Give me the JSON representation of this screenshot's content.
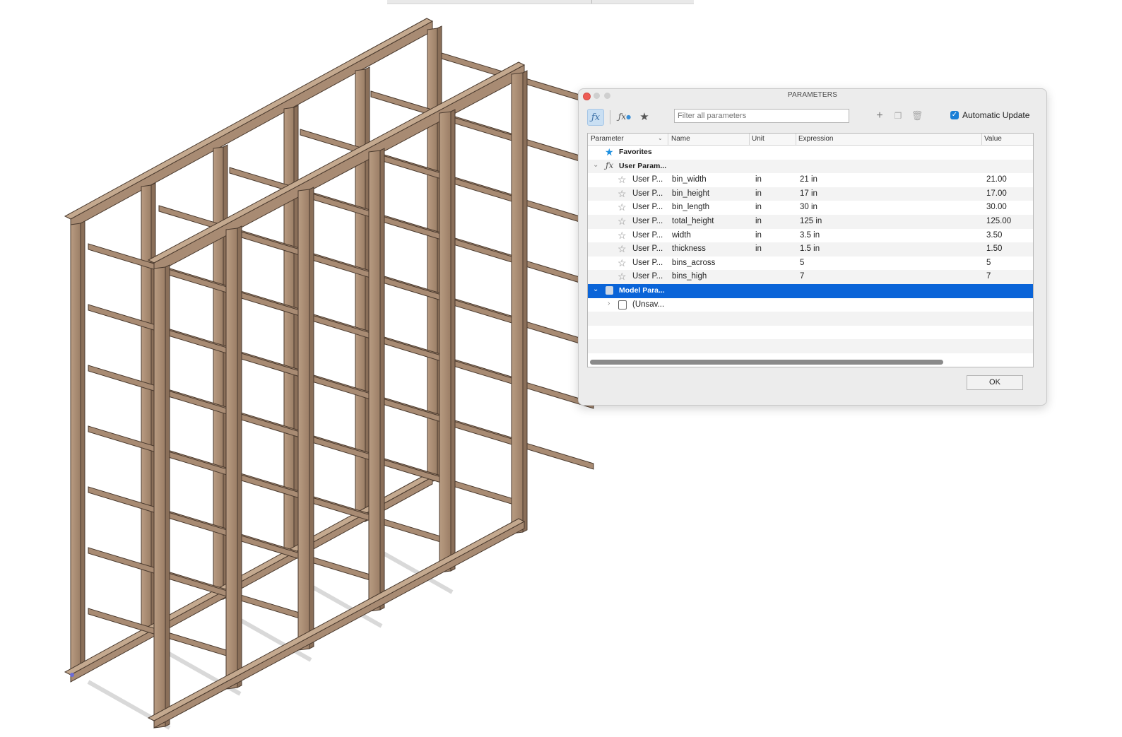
{
  "dialog": {
    "title": "PARAMETERS",
    "filter_placeholder": "Filter all parameters",
    "auto_update_label": "Automatic Update",
    "auto_update_checked": true,
    "ok_label": "OK",
    "toolbar_icons": [
      "fx-icon",
      "fx-user-icon",
      "star-icon",
      "plus-icon",
      "copy-icon",
      "trash-icon"
    ]
  },
  "table": {
    "columns": [
      "Parameter",
      "Name",
      "Unit",
      "Expression",
      "Value"
    ],
    "favorites_label": "Favorites",
    "user_group_label": "User Param...",
    "user_params": [
      {
        "param": "User P...",
        "name": "bin_width",
        "unit": "in",
        "expression": "21 in",
        "value": "21.00"
      },
      {
        "param": "User P...",
        "name": "bin_height",
        "unit": "in",
        "expression": "17 in",
        "value": "17.00"
      },
      {
        "param": "User P...",
        "name": "bin_length",
        "unit": "in",
        "expression": "30 in",
        "value": "30.00"
      },
      {
        "param": "User P...",
        "name": "total_height",
        "unit": "in",
        "expression": "125 in",
        "value": "125.00"
      },
      {
        "param": "User P...",
        "name": "width",
        "unit": "in",
        "expression": "3.5 in",
        "value": "3.50"
      },
      {
        "param": "User P...",
        "name": "thickness",
        "unit": "in",
        "expression": "1.5 in",
        "value": "1.50"
      },
      {
        "param": "User P...",
        "name": "bins_across",
        "unit": "",
        "expression": "5",
        "value": "5"
      },
      {
        "param": "User P...",
        "name": "bins_high",
        "unit": "",
        "expression": "7",
        "value": "7"
      }
    ],
    "model_group_label": "Model Para...",
    "model_child_label": "(Unsav..."
  },
  "colors": {
    "selection": "#0a64d8",
    "wood": "#a88b73",
    "accent": "#1a7fd6"
  }
}
